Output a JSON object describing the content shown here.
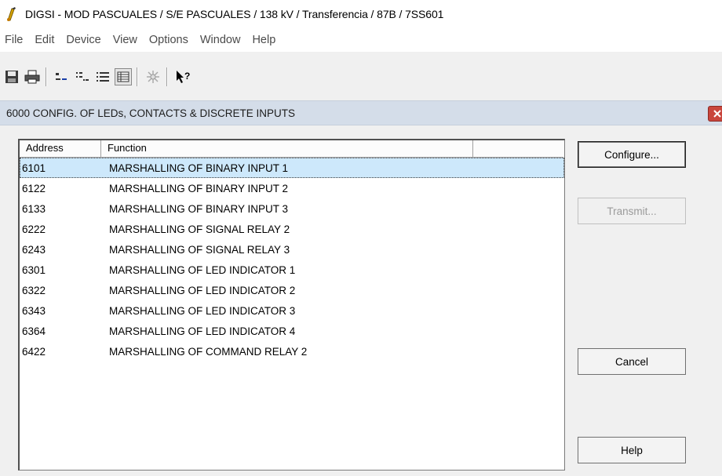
{
  "window": {
    "title": "DIGSI - MOD PASCUALES / S/E PASCUALES / 138 kV / Transferencia / 87B / 7SS601"
  },
  "menu": {
    "items": [
      "File",
      "Edit",
      "Device",
      "View",
      "Options",
      "Window",
      "Help"
    ]
  },
  "toolbar": {
    "icons": [
      "save-icon",
      "print-icon",
      "small-icons-icon",
      "list-view-icon",
      "details-view-icon",
      "detail-grid-icon",
      "wand-icon",
      "context-help-icon"
    ]
  },
  "document": {
    "title": "6000  CONFIG. OF LEDs, CONTACTS & DISCRETE INPUTS"
  },
  "list": {
    "columns": [
      "Address",
      "Function",
      ""
    ],
    "rows": [
      {
        "address": "6101",
        "function": "MARSHALLING OF BINARY INPUT 1"
      },
      {
        "address": "6122",
        "function": "MARSHALLING OF BINARY INPUT 2"
      },
      {
        "address": "6133",
        "function": "MARSHALLING OF BINARY INPUT 3"
      },
      {
        "address": "6222",
        "function": "MARSHALLING OF SIGNAL RELAY 2"
      },
      {
        "address": "6243",
        "function": "MARSHALLING OF SIGNAL RELAY 3"
      },
      {
        "address": "6301",
        "function": "MARSHALLING OF LED INDICATOR 1"
      },
      {
        "address": "6322",
        "function": "MARSHALLING OF LED INDICATOR 2"
      },
      {
        "address": "6343",
        "function": "MARSHALLING OF LED INDICATOR 3"
      },
      {
        "address": "6364",
        "function": "MARSHALLING OF LED INDICATOR 4"
      },
      {
        "address": "6422",
        "function": "MARSHALLING OF COMMAND RELAY 2"
      }
    ],
    "selected_index": 0
  },
  "buttons": {
    "configure": "Configure...",
    "transmit": "Transmit...",
    "cancel": "Cancel",
    "help": "Help"
  },
  "colors": {
    "selection": "#cde8fb",
    "doc_title_bg": "#d4dde9",
    "close_button": "#c9463d"
  }
}
